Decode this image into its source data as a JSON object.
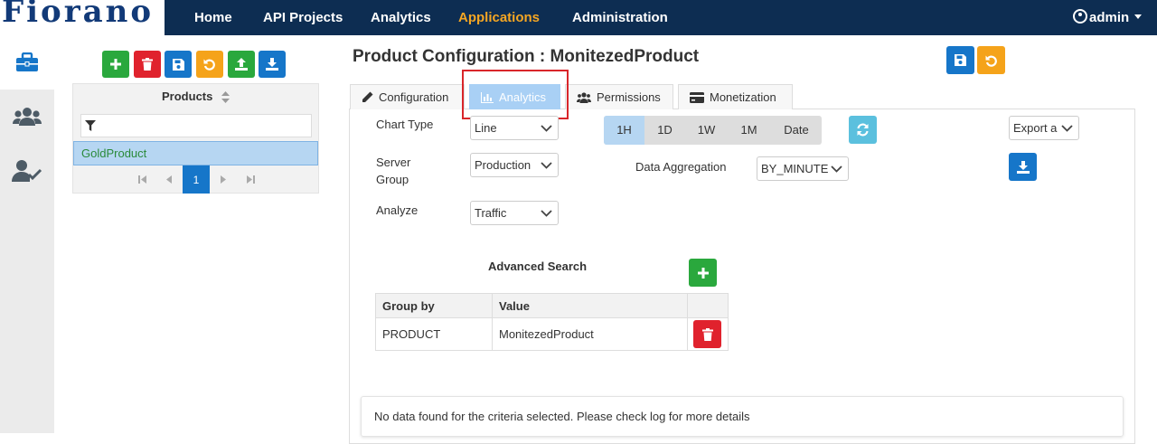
{
  "brand": {
    "logo_text": "Fiorano"
  },
  "nav": {
    "items": [
      {
        "label": "Home"
      },
      {
        "label": "API Projects"
      },
      {
        "label": "Analytics"
      },
      {
        "label": "Applications"
      },
      {
        "label": "Administration"
      }
    ],
    "active": "Applications",
    "user": "admin"
  },
  "sidebar": {
    "items": [
      {
        "icon": "briefcase-icon",
        "active": true
      },
      {
        "icon": "users-icon",
        "active": false
      },
      {
        "icon": "user-check-icon",
        "active": false
      }
    ]
  },
  "products": {
    "toolbar": [
      {
        "icon": "plus-icon",
        "color": "#2aa83d"
      },
      {
        "icon": "trash-icon",
        "color": "#e0222d"
      },
      {
        "icon": "save-icon",
        "color": "#1676c9"
      },
      {
        "icon": "undo-icon",
        "color": "#f5a31a"
      },
      {
        "icon": "upload-icon",
        "color": "#2aa83d"
      },
      {
        "icon": "download-icon",
        "color": "#1676c9"
      }
    ],
    "header": "Products",
    "filter_value": "",
    "rows": [
      {
        "name": "GoldProduct",
        "selected": true
      }
    ],
    "pagination": {
      "current": "1"
    }
  },
  "page": {
    "title": "Product Configuration : MonitezedProduct",
    "header_buttons": [
      {
        "icon": "save-icon",
        "color": "#1676c9"
      },
      {
        "icon": "undo-icon",
        "color": "#f5a31a"
      }
    ]
  },
  "tabs": [
    {
      "label": "Configuration",
      "icon": "pencil-icon"
    },
    {
      "label": "Analytics",
      "icon": "chart-icon"
    },
    {
      "label": "Permissions",
      "icon": "users-icon"
    },
    {
      "label": "Monetization",
      "icon": "credit-card-icon"
    }
  ],
  "active_tab": "Analytics",
  "analytics": {
    "chart_type": {
      "label": "Chart Type",
      "value": "Line"
    },
    "server_group": {
      "label_line1": "Server",
      "label_line2": "Group",
      "value": "Production"
    },
    "analyze": {
      "label": "Analyze",
      "value": "Traffic"
    },
    "time_ranges": [
      "1H",
      "1D",
      "1W",
      "1M",
      "Date"
    ],
    "active_range": "1H",
    "data_aggregation": {
      "label": "Data Aggregation",
      "value": "BY_MINUTE"
    },
    "export": {
      "value": "Export a"
    },
    "advanced_search": {
      "title": "Advanced Search",
      "columns": [
        "Group by",
        "Value"
      ],
      "rows": [
        {
          "group_by": "PRODUCT",
          "value": "MonitezedProduct"
        }
      ]
    },
    "message": "No data found for the criteria selected. Please check log for more details"
  },
  "colors": {
    "navbar": "#0d2d52",
    "accent_orange": "#f5a623",
    "primary_blue": "#1676c9",
    "success_green": "#2aa83d",
    "danger_red": "#e0222d",
    "refresh_teal": "#5bc0de",
    "highlight_red": "#d9262a"
  }
}
